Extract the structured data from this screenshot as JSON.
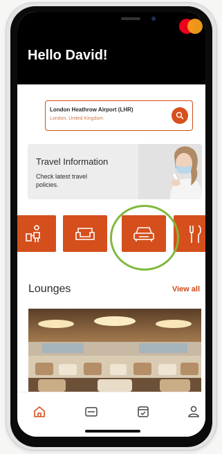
{
  "header": {
    "greeting": "Hello David!",
    "brand_logo": "mastercard-logo",
    "colors": {
      "background": "#000000",
      "text": "#ffffff"
    }
  },
  "search": {
    "location_title": "London Heathrow Airport (LHR)",
    "location_subtitle": "London, United Kingdom",
    "button_icon": "search-icon"
  },
  "travel_info": {
    "title": "Travel Information",
    "subtitle": "Check latest travel policies.",
    "image": "woman-with-mask-and-phone"
  },
  "categories": [
    {
      "icon": "concierge-icon",
      "name": "concierge"
    },
    {
      "icon": "lounge-sofa-icon",
      "name": "lounge"
    },
    {
      "icon": "car-icon",
      "name": "car",
      "highlighted": true
    },
    {
      "icon": "dining-icon",
      "name": "dining"
    }
  ],
  "lounges": {
    "title": "Lounges",
    "view_all": "View all",
    "image": "airport-lounge-interior"
  },
  "bottom_nav": [
    {
      "icon": "home-icon",
      "active": true
    },
    {
      "icon": "card-icon"
    },
    {
      "icon": "calendar-check-icon"
    },
    {
      "icon": "profile-icon"
    }
  ],
  "colors": {
    "accent": "#d54f1c",
    "highlight_ring": "#7fb93c"
  }
}
